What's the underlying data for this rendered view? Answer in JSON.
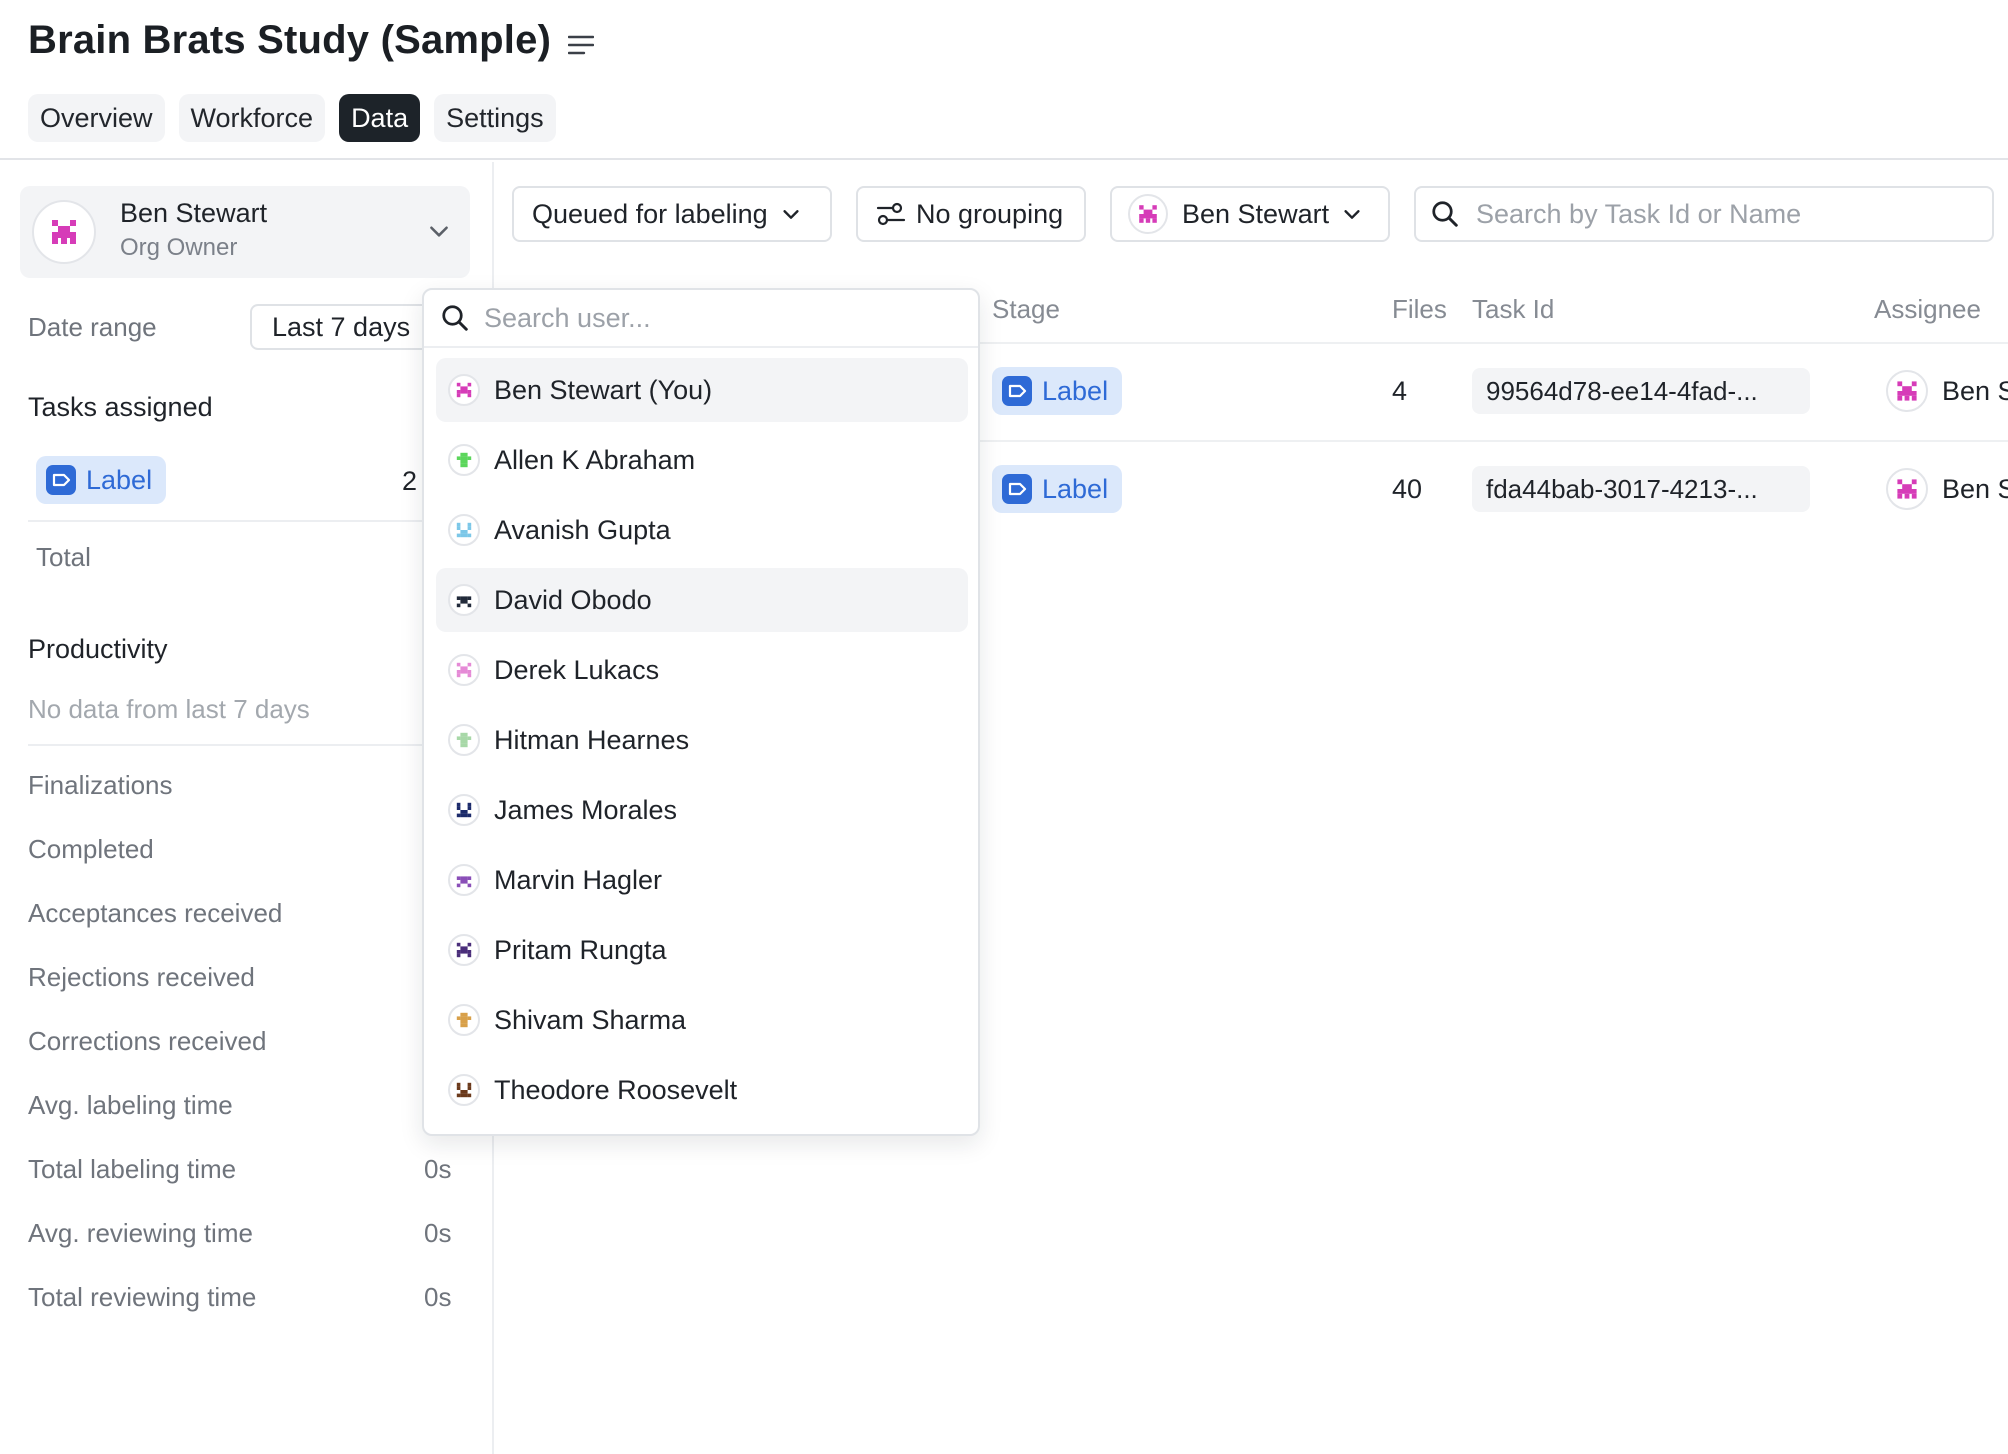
{
  "header": {
    "title": "Brain Brats Study (Sample)",
    "tabs": [
      {
        "label": "Overview",
        "active": false
      },
      {
        "label": "Workforce",
        "active": false
      },
      {
        "label": "Data",
        "active": true
      },
      {
        "label": "Settings",
        "active": false
      }
    ]
  },
  "sidebar": {
    "user": {
      "name": "Ben Stewart",
      "role": "Org Owner"
    },
    "date_range_label": "Date range",
    "date_range_value": "Last 7 days",
    "tasks_assigned_title": "Tasks assigned",
    "task_stage_chip": "Label",
    "task_stage_count": "2",
    "total_label": "Total",
    "productivity_title": "Productivity",
    "productivity_empty": "No data from last 7 days",
    "metrics": [
      {
        "label": "Finalizations",
        "value": ""
      },
      {
        "label": "Completed",
        "value": ""
      },
      {
        "label": "Acceptances received",
        "value": ""
      },
      {
        "label": "Rejections received",
        "value": ""
      },
      {
        "label": "Corrections received",
        "value": ""
      },
      {
        "label": "Avg. labeling time",
        "value": ""
      },
      {
        "label": "Total labeling time",
        "value": "0s"
      },
      {
        "label": "Avg. reviewing time",
        "value": "0s"
      },
      {
        "label": "Total reviewing time",
        "value": "0s"
      }
    ]
  },
  "toolbar": {
    "status_filter": "Queued for labeling",
    "grouping": "No grouping",
    "assignee_filter": "Ben Stewart",
    "search_placeholder": "Search by Task Id or Name"
  },
  "table": {
    "columns": {
      "stage": "Stage",
      "files": "Files",
      "task_id": "Task Id",
      "assignee": "Assignee"
    },
    "rows": [
      {
        "stage": "Label",
        "files": "4",
        "task_id": "99564d78-ee14-4fad-...",
        "assignee": "Ben S"
      },
      {
        "stage": "Label",
        "files": "40",
        "task_id": "fda44bab-3017-4213-...",
        "assignee": "Ben S"
      }
    ]
  },
  "user_dropdown": {
    "search_placeholder": "Search user...",
    "users": [
      {
        "name": "Ben Stewart  (You)",
        "color": "#d63cb8"
      },
      {
        "name": "Allen K Abraham",
        "color": "#5cd65c"
      },
      {
        "name": "Avanish Gupta",
        "color": "#7cc7e8"
      },
      {
        "name": "David Obodo",
        "color": "#222a3a"
      },
      {
        "name": "Derek Lukacs",
        "color": "#e58ad6"
      },
      {
        "name": "Hitman Hearnes",
        "color": "#a8d8a8"
      },
      {
        "name": "James Morales",
        "color": "#1c2b6b"
      },
      {
        "name": "Marvin Hagler",
        "color": "#8a4fb8"
      },
      {
        "name": "Pritam Rungta",
        "color": "#4a2e7a"
      },
      {
        "name": "Shivam Sharma",
        "color": "#d8a04a"
      },
      {
        "name": "Theodore Roosevelt",
        "color": "#6b3a1c"
      }
    ]
  },
  "colors": {
    "accent": "#2e6ad6",
    "chip_bg": "#dbe8fb",
    "active_tab": "#1d2329",
    "owner_avatar": "#d63cb8"
  }
}
